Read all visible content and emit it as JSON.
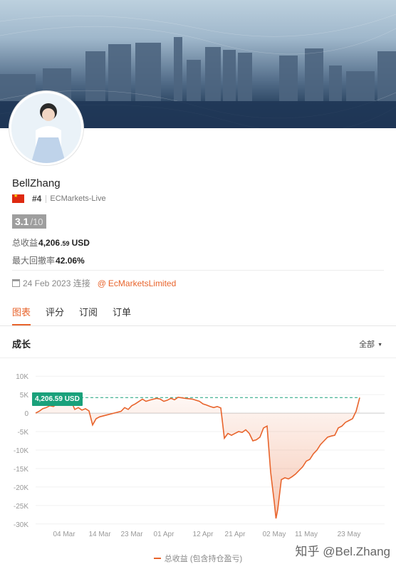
{
  "profile": {
    "username": "BellZhang",
    "rank": "#4",
    "broker": "ECMarkets-Live",
    "score_main": "3.1",
    "score_out": "/10"
  },
  "stats": {
    "total_profit_label": "总收益",
    "total_profit_int": "4,206",
    "total_profit_dec": ".59",
    "total_profit_unit": "USD",
    "max_drawdown_label": "最大回撤率",
    "max_drawdown_value": "42.06%"
  },
  "meta": {
    "connected_date": "24 Feb 2023 连接",
    "at_symbol": "@",
    "link_text": "EcMarketsLimited"
  },
  "tabs": [
    "图表",
    "评分",
    "订阅",
    "订单"
  ],
  "section": {
    "title": "成长",
    "filter_label": "全部"
  },
  "current_tag": "4,206.59 USD",
  "legend_label": "总收益 (包含持仓盈亏)",
  "watermark": "知乎 @Bel.Zhang",
  "colors": {
    "accent": "#e8642c",
    "tag_bg": "#1aa17b",
    "line": "#e8642c"
  },
  "chart_data": {
    "type": "area",
    "y_tick_labels": [
      "10K",
      "5K",
      "0",
      "-5K",
      "-10K",
      "-15K",
      "-20K",
      "-25K",
      "-30K"
    ],
    "y_ticks": [
      10000,
      5000,
      0,
      -5000,
      -10000,
      -15000,
      -20000,
      -25000,
      -30000
    ],
    "ylim": [
      -31000,
      11000
    ],
    "x_tick_labels": [
      "04 Mar",
      "14 Mar",
      "23 Mar",
      "01 Apr",
      "12 Apr",
      "21 Apr",
      "02 May",
      "11 May",
      "23 May"
    ],
    "x_tick_days": [
      8,
      18,
      27,
      36,
      47,
      56,
      67,
      76,
      88
    ],
    "xlim": [
      0,
      98
    ],
    "reference_line": 4206.59,
    "series": [
      {
        "name": "总收益 (包含持仓盈亏)",
        "points": [
          [
            0,
            0
          ],
          [
            1,
            500
          ],
          [
            2,
            1200
          ],
          [
            3,
            1500
          ],
          [
            4,
            2000
          ],
          [
            5,
            1800
          ],
          [
            6,
            2500
          ],
          [
            7,
            3200
          ],
          [
            9,
            3600
          ],
          [
            10,
            3200
          ],
          [
            11,
            1000
          ],
          [
            12,
            1500
          ],
          [
            13,
            800
          ],
          [
            14,
            1200
          ],
          [
            15,
            600
          ],
          [
            16,
            -3200
          ],
          [
            17,
            -1500
          ],
          [
            18,
            -1000
          ],
          [
            20,
            -500
          ],
          [
            22,
            0
          ],
          [
            24,
            500
          ],
          [
            25,
            1500
          ],
          [
            26,
            1000
          ],
          [
            27,
            2000
          ],
          [
            28,
            2500
          ],
          [
            30,
            3800
          ],
          [
            31,
            3200
          ],
          [
            32,
            3500
          ],
          [
            34,
            4000
          ],
          [
            35,
            3800
          ],
          [
            36,
            3200
          ],
          [
            37,
            3500
          ],
          [
            38,
            4000
          ],
          [
            39,
            3600
          ],
          [
            40,
            4300
          ],
          [
            42,
            4000
          ],
          [
            44,
            3800
          ],
          [
            46,
            3200
          ],
          [
            47,
            2500
          ],
          [
            48,
            2200
          ],
          [
            49,
            1800
          ],
          [
            50,
            1500
          ],
          [
            51,
            1800
          ],
          [
            52,
            1400
          ],
          [
            53,
            -6800
          ],
          [
            54,
            -5500
          ],
          [
            55,
            -6000
          ],
          [
            56,
            -5500
          ],
          [
            57,
            -5000
          ],
          [
            58,
            -5200
          ],
          [
            59,
            -4500
          ],
          [
            60,
            -5500
          ],
          [
            61,
            -7500
          ],
          [
            62,
            -7200
          ],
          [
            63,
            -6500
          ],
          [
            64,
            -4000
          ],
          [
            65,
            -3500
          ],
          [
            66,
            -16000
          ],
          [
            67,
            -24000
          ],
          [
            67.5,
            -28500
          ],
          [
            68,
            -26000
          ],
          [
            69,
            -18000
          ],
          [
            70,
            -17500
          ],
          [
            71,
            -17800
          ],
          [
            72,
            -17200
          ],
          [
            73,
            -16500
          ],
          [
            74,
            -15500
          ],
          [
            75,
            -14500
          ],
          [
            76,
            -13000
          ],
          [
            77,
            -12500
          ],
          [
            78,
            -11000
          ],
          [
            79,
            -10000
          ],
          [
            80,
            -8500
          ],
          [
            81,
            -7500
          ],
          [
            82,
            -6500
          ],
          [
            83,
            -6200
          ],
          [
            84,
            -6000
          ],
          [
            85,
            -4000
          ],
          [
            86,
            -3500
          ],
          [
            87,
            -2500
          ],
          [
            88,
            -2000
          ],
          [
            89,
            -1500
          ],
          [
            90,
            500
          ],
          [
            91,
            4206.59
          ]
        ]
      }
    ]
  }
}
